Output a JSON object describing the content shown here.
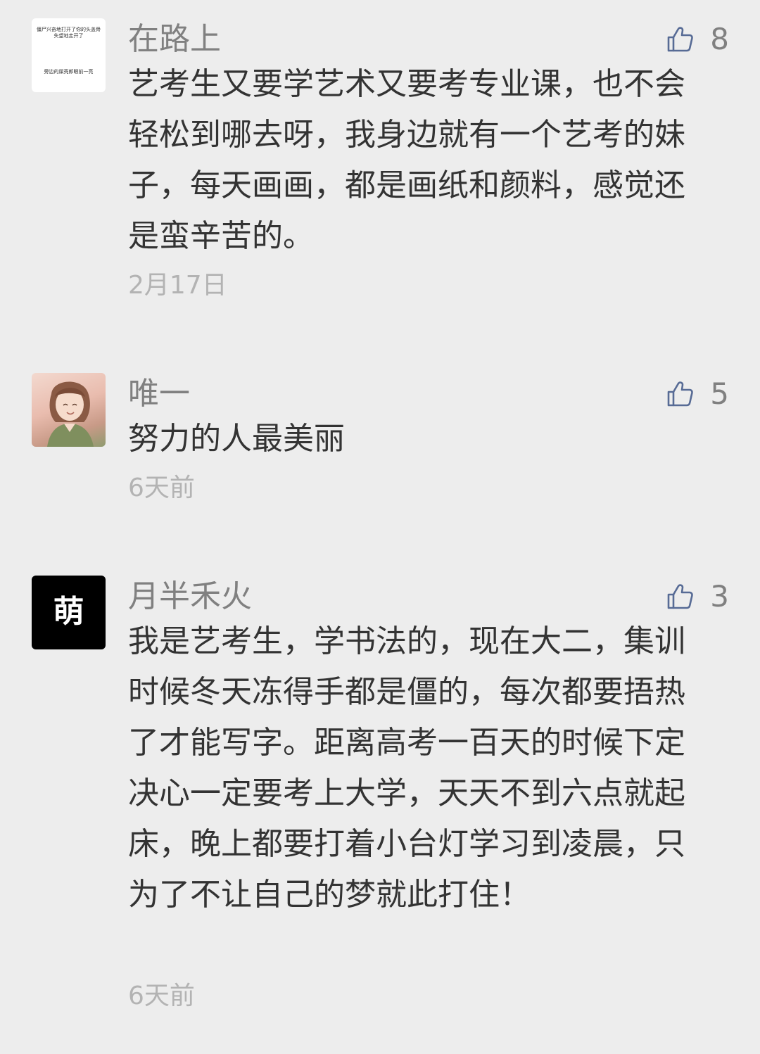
{
  "comments": [
    {
      "user": "在路上",
      "avatar_text": [
        "僵尸兴奋地打开了你的头盖骨",
        "失望地走开了",
        "旁边的屎壳郎眼前一亮"
      ],
      "likes": "8",
      "content": "艺考生又要学艺术又要考专业课，也不会轻松到哪去呀，我身边就有一个艺考的妹子，每天画画，都是画纸和颜料，感觉还是蛮辛苦的。",
      "time": "2月17日"
    },
    {
      "user": "唯一",
      "likes": "5",
      "content": "努力的人最美丽",
      "time": "6天前"
    },
    {
      "user": "月半禾火",
      "avatar_text": "萌",
      "likes": "3",
      "content": "我是艺考生，学书法的，现在大二，集训时候冬天冻得手都是僵的，每次都要捂热了才能写字。距离高考一百天的时候下定决心一定要考上大学，天天不到六点就起床，晚上都要打着小台灯学习到凌晨，只为了不让自己的梦就此打住！",
      "time": "6天前"
    }
  ],
  "colors": {
    "background": "#ededed",
    "name": "#808080",
    "content": "#333333",
    "time": "#b3b3b3",
    "like_icon": "#576b95"
  },
  "icons": {
    "like": "thumbs-up-icon"
  }
}
